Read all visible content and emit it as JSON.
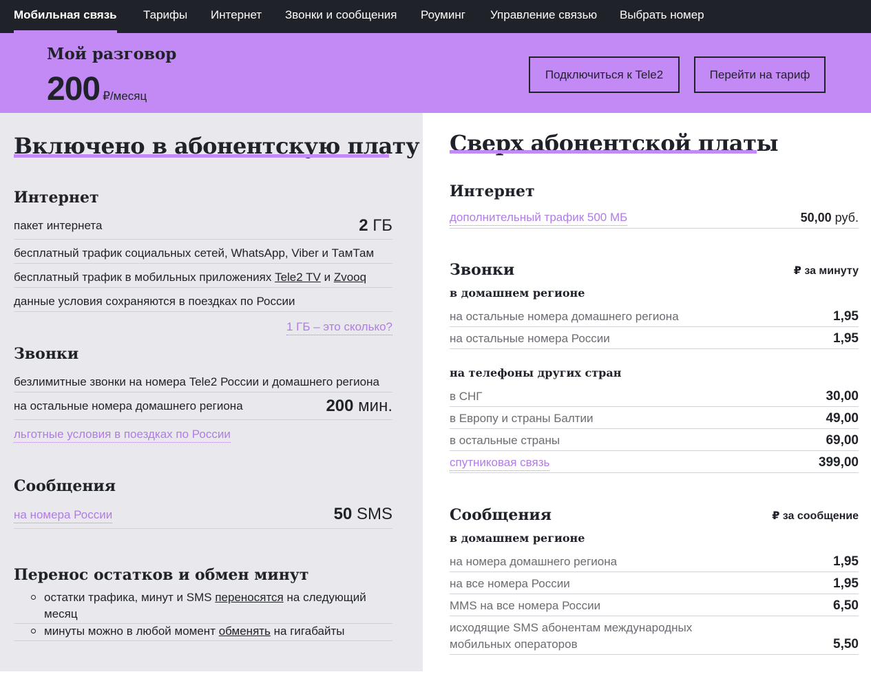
{
  "nav": {
    "items": [
      "Мобильная связь",
      "Тарифы",
      "Интернет",
      "Звонки и сообщения",
      "Роуминг",
      "Управление связью",
      "Выбрать номер"
    ],
    "active_index": 0
  },
  "hero": {
    "tariff_name": "Мой разговор",
    "price": "200",
    "price_unit": "₽/месяц",
    "connect_button": "Подключиться к Tele2",
    "switch_button": "Перейти на тариф"
  },
  "included": {
    "title": "Включено в абонентскую плату",
    "internet": {
      "title": "Интернет",
      "package_label": "пакет интернета",
      "package_value": "2",
      "package_unit": "ГБ",
      "social_label": "бесплатный трафик социальных сетей, WhatsApp, Viber и ТамТам",
      "apps_prefix": "бесплатный трафик в мобильных приложениях",
      "apps_link1": "Tele2 TV",
      "apps_and": "и",
      "apps_link2": "Zvooq",
      "trips_label": "данные условия сохраняются в поездках по России",
      "gb_link": "1 ГБ – это сколько?"
    },
    "calls": {
      "title": "Звонки",
      "unlimited_label": "безлимитные звонки на номера Tele2 России и домашнего региона",
      "other_label": "на остальные номера домашнего региона",
      "other_value": "200",
      "other_unit": "мин.",
      "trips_link": "льготные условия в поездках по России"
    },
    "messages": {
      "title": "Сообщения",
      "link": "на номера России",
      "value": "50",
      "unit": "SMS"
    },
    "carryover": {
      "title": "Перенос остатков и обмен минут",
      "item1_prefix": "остатки трафика, минут и SMS",
      "item1_link": "переносятся",
      "item1_suffix": "на следующий",
      "item1_line2": "месяц",
      "item2_prefix": "минуты можно в любой момент",
      "item2_link": "обменять",
      "item2_suffix": "на гигабайты"
    }
  },
  "extra": {
    "title": "Сверх абонентской платы",
    "internet": {
      "title": "Интернет",
      "traffic_link": "дополнительный трафик 500 МБ",
      "traffic_value": "50,00",
      "traffic_unit": "руб."
    },
    "calls": {
      "title": "Звонки",
      "unit_header": "₽ за минуту",
      "home_subtitle": "в домашнем регионе",
      "home_rows": [
        {
          "label": "на остальные номера домашнего региона",
          "value": "1,95"
        },
        {
          "label": "на остальные номера России",
          "value": "1,95"
        }
      ],
      "intl_subtitle": "на телефоны других стран",
      "intl_rows": [
        {
          "label": "в СНГ",
          "value": "30,00"
        },
        {
          "label": "в Европу и страны Балтии",
          "value": "49,00"
        },
        {
          "label": "в остальные страны",
          "value": "69,00"
        }
      ],
      "satellite_link": "спутниковая связь",
      "satellite_value": "399,00"
    },
    "messages": {
      "title": "Сообщения",
      "unit_header": "₽ за сообщение",
      "subtitle": "в домашнем регионе",
      "rows": [
        {
          "label": "на номера домашнего региона",
          "value": "1,95"
        },
        {
          "label": "на все номера России",
          "value": "1,95"
        },
        {
          "label": "MMS на все номера России",
          "value": "6,50"
        }
      ],
      "intl_label_line1": "исходящие SMS абонентам международных",
      "intl_label_line2": "мобильных операторов",
      "intl_value": "5,50"
    }
  },
  "colors": {
    "accent": "#c38af5",
    "dark": "#1f2229",
    "left_bg": "#e9e8ec",
    "link": "#b07ce6"
  }
}
